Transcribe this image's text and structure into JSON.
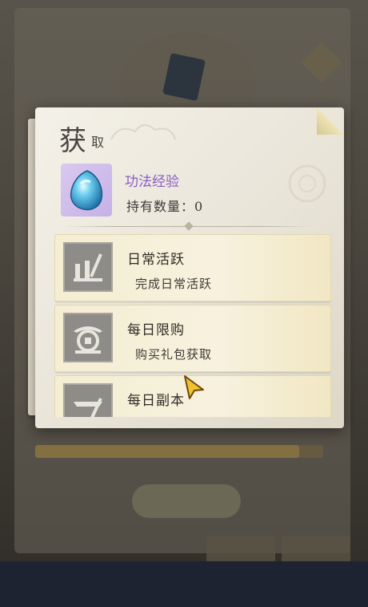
{
  "popup": {
    "title_big": "获",
    "title_small": "取",
    "item": {
      "name": "功法经验",
      "quantity_label": "持有数量：0",
      "icon": "blue-gem-icon"
    },
    "sources": [
      {
        "title": "日常活跃",
        "desc": "完成日常活跃",
        "icon": "activity-brush-icon"
      },
      {
        "title": "每日限购",
        "desc": "购买礼包获取",
        "icon": "shop-coin-icon"
      },
      {
        "title": "每日副本",
        "desc": "",
        "icon": "dungeon-icon"
      }
    ]
  },
  "colors": {
    "item_name": "#8a5cc4",
    "item_bg": "#c6b1e7",
    "row_bg": "#f6eed3",
    "icon_bg": "#8e8c88"
  }
}
